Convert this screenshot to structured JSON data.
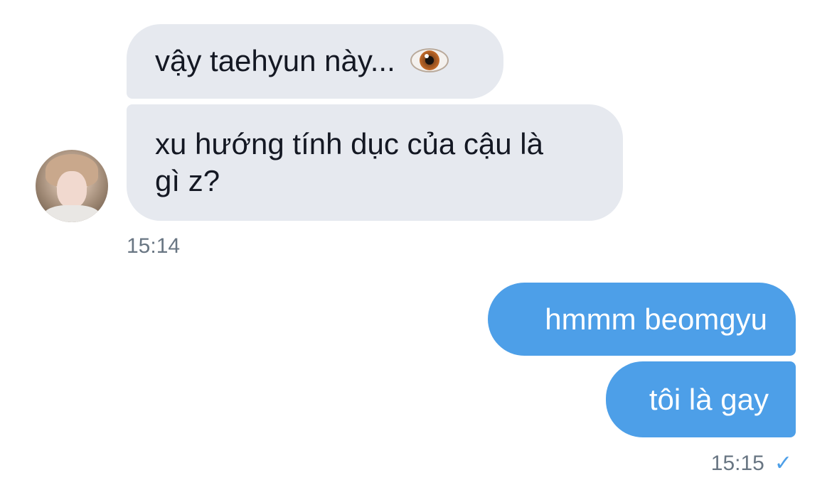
{
  "conversation": {
    "incoming": {
      "messages": [
        {
          "text": "vậy taehyun này... ",
          "emoji": "eye-emoji"
        },
        {
          "text": "xu hướng tính dục của cậu là\ngì z?"
        }
      ],
      "timestamp": "15:14",
      "avatar": "contact-avatar"
    },
    "outgoing": {
      "messages": [
        {
          "text": "hmmm beomgyu"
        },
        {
          "text": "tôi là gay"
        }
      ],
      "timestamp": "15:15",
      "status_icon": "read-check-icon"
    }
  },
  "colors": {
    "incoming_bubble": "#e6e9ef",
    "outgoing_bubble": "#4d9fe8",
    "timestamp": "#697683",
    "check": "#4d9fe8"
  }
}
